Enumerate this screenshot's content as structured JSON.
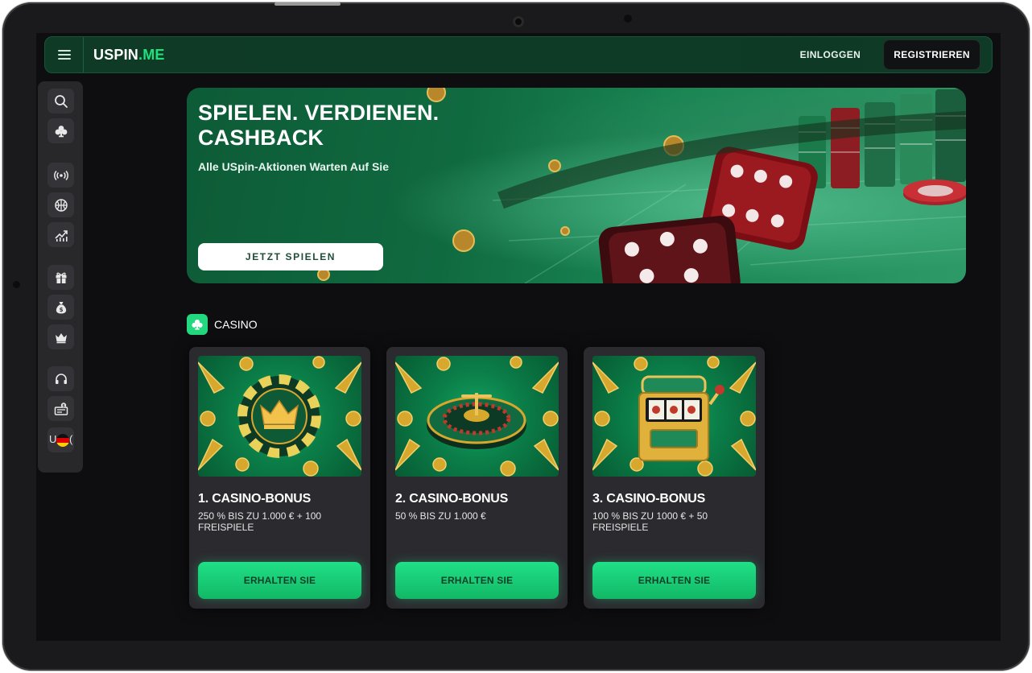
{
  "header": {
    "menu_icon": "hamburger-icon",
    "logo_part1": "USPIN",
    "logo_part2": ".ME",
    "login_label": "EINLOGGEN",
    "register_label": "REGISTRIEREN",
    "accent_color": "#1ee07d"
  },
  "sidebar": {
    "items": [
      {
        "icon": "search-icon"
      },
      {
        "icon": "club-icon"
      },
      {
        "icon": "live-broadcast-icon"
      },
      {
        "icon": "basketball-icon"
      },
      {
        "icon": "trending-chart-icon"
      },
      {
        "icon": "gift-icon"
      },
      {
        "icon": "money-bag-icon"
      },
      {
        "icon": "crown-icon"
      },
      {
        "icon": "headset-icon"
      },
      {
        "icon": "cashier-icon"
      }
    ],
    "language": {
      "code_prefix": "U",
      "code_suffix": "(",
      "flag": "germany-flag-icon"
    }
  },
  "hero": {
    "title": "SPIELEN. VERDIENEN. CASHBACK",
    "subtitle": "Alle USpin-Aktionen Warten Auf Sie",
    "cta_label": "JETZT SPIELEN"
  },
  "section": {
    "title": "CASINO",
    "icon": "club-icon"
  },
  "cards": [
    {
      "title": "1. CASINO-BONUS",
      "description": "250 % BIS ZU 1.000 € + 100 FREISPIELE",
      "cta_label": "ERHALTEN SIE",
      "image": "poker-chip-crown"
    },
    {
      "title": "2. CASINO-BONUS",
      "description": "50 % BIS ZU 1.000 €",
      "cta_label": "ERHALTEN SIE",
      "image": "roulette-wheel"
    },
    {
      "title": "3. CASINO-BONUS",
      "description": "100 % BIS ZU 1000 € + 50 FREISPIELE",
      "cta_label": "ERHALTEN SIE",
      "image": "slot-machine"
    }
  ]
}
